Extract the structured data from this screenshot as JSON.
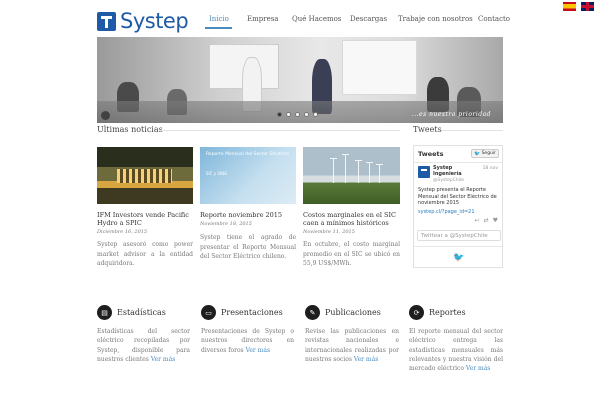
{
  "logo": {
    "text": "Systep"
  },
  "nav": [
    {
      "label": "Inicio",
      "active": true
    },
    {
      "label": "Empresa",
      "active": false
    },
    {
      "label": "Qué Hacemos",
      "active": false
    },
    {
      "label": "Descargas",
      "active": false
    },
    {
      "label": "Trabaje con nosotros",
      "active": false
    },
    {
      "label": "Contacto",
      "active": false
    }
  ],
  "languages": [
    {
      "icon": "flag-spain-icon"
    },
    {
      "icon": "flag-uk-icon"
    }
  ],
  "hero": {
    "tagline": "...es nuestra prioridad",
    "slide_count": 5,
    "active_slide": 1
  },
  "news": {
    "section_title": "Ultimas noticias",
    "items": [
      {
        "title": "IFM Investors vende Pacific Hydro a SPIC",
        "date": "Diciembre 16, 2015",
        "body": "Systep asesoró como power market advisor a la entidad adquiridora."
      },
      {
        "title": "Reporte noviembre 2015",
        "date": "Noviembre 18, 2015",
        "body": "Systep tiene el agrado de presentar el Reporte Mensual del Sector Eléctrico chileno.",
        "image_title": "Reporte Mensual del Sector Eléctrico",
        "image_sub": "SIC y SING"
      },
      {
        "title": "Costos marginales en el SIC caen a mínimos históricos",
        "date": "Noviembre 11, 2015",
        "body": "En octubre, el costo marginal promedio en el SIC se ubicó en 55,9 US$/MWh."
      }
    ]
  },
  "tweets": {
    "section_title": "Tweets",
    "header": "Tweets",
    "follow_label": "Seguir",
    "author_name": "Systep Ingeniería",
    "author_handle": "@SystepChile",
    "time": "18 nov",
    "text": "Systep presenta el Reporte Mensual del Sector Eléctrico de noviembre 2015",
    "link": "systep.cl/?page_id=21",
    "compose_placeholder": "Twittear a @SystepChile"
  },
  "features": [
    {
      "title": "Estadísticas",
      "body": "Estadísticas del sector eléctrico recopiladas por Systep, disponible para nuestros clientes",
      "link": "Ver más",
      "icon": "chart-icon"
    },
    {
      "title": "Presentaciones",
      "body": "Presentaciones de Systep o nuestros directores en diversos foros",
      "link": "Ver más",
      "icon": "presentation-icon"
    },
    {
      "title": "Publicaciones",
      "body": "Revise las publicaciones en revistas nacionales e internacionales realizadas por nuestros socios",
      "link": "Ver más",
      "icon": "publication-icon"
    },
    {
      "title": "Reportes",
      "body": "El reporte mensual del sector eléctrico entrega las estadísticas mensuales más relevantes y nuestra visión del mercado eléctrico",
      "link": "Ver más",
      "icon": "report-icon"
    }
  ],
  "colors": {
    "brand": "#1f5aa6",
    "accent": "#4a8bbf"
  }
}
